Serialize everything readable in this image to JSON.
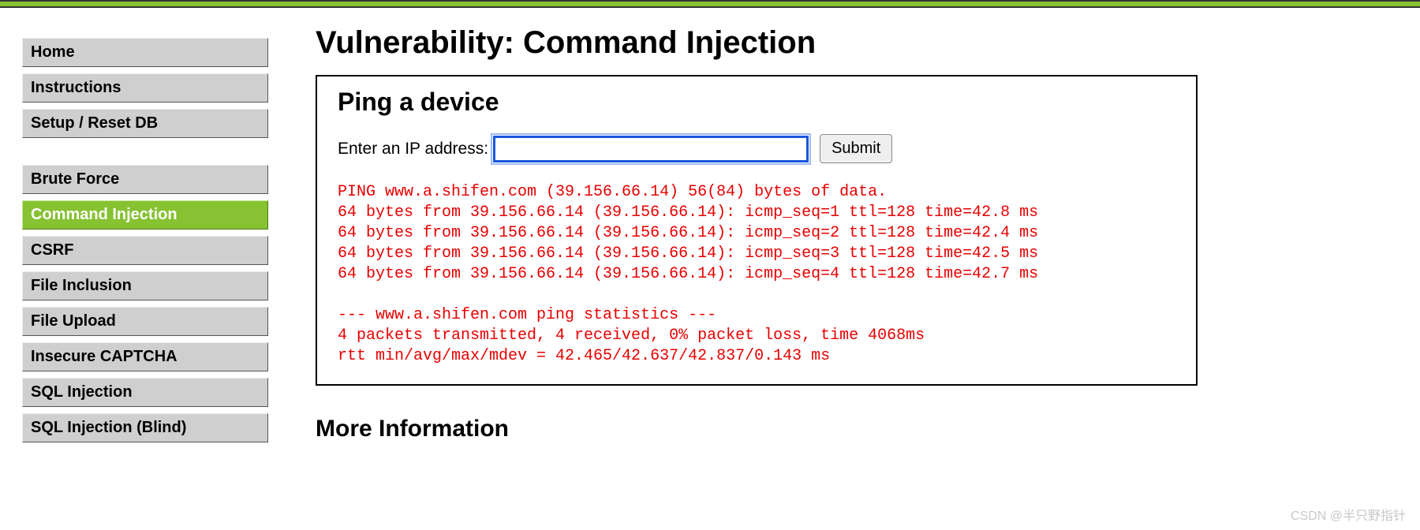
{
  "sidebar": {
    "group1": [
      {
        "label": "Home",
        "active": false
      },
      {
        "label": "Instructions",
        "active": false
      },
      {
        "label": "Setup / Reset DB",
        "active": false
      }
    ],
    "group2": [
      {
        "label": "Brute Force",
        "active": false
      },
      {
        "label": "Command Injection",
        "active": true
      },
      {
        "label": "CSRF",
        "active": false
      },
      {
        "label": "File Inclusion",
        "active": false
      },
      {
        "label": "File Upload",
        "active": false
      },
      {
        "label": "Insecure CAPTCHA",
        "active": false
      },
      {
        "label": "SQL Injection",
        "active": false
      },
      {
        "label": "SQL Injection (Blind)",
        "active": false
      }
    ]
  },
  "main": {
    "title": "Vulnerability: Command Injection",
    "panel_title": "Ping a device",
    "form_label": "Enter an IP address:",
    "ip_value": "",
    "submit_label": "Submit",
    "output": "PING www.a.shifen.com (39.156.66.14) 56(84) bytes of data.\n64 bytes from 39.156.66.14 (39.156.66.14): icmp_seq=1 ttl=128 time=42.8 ms\n64 bytes from 39.156.66.14 (39.156.66.14): icmp_seq=2 ttl=128 time=42.4 ms\n64 bytes from 39.156.66.14 (39.156.66.14): icmp_seq=3 ttl=128 time=42.5 ms\n64 bytes from 39.156.66.14 (39.156.66.14): icmp_seq=4 ttl=128 time=42.7 ms\n\n--- www.a.shifen.com ping statistics ---\n4 packets transmitted, 4 received, 0% packet loss, time 4068ms\nrtt min/avg/max/mdev = 42.465/42.637/42.837/0.143 ms",
    "more_info_heading": "More Information"
  },
  "watermark": "CSDN @半只野指针"
}
